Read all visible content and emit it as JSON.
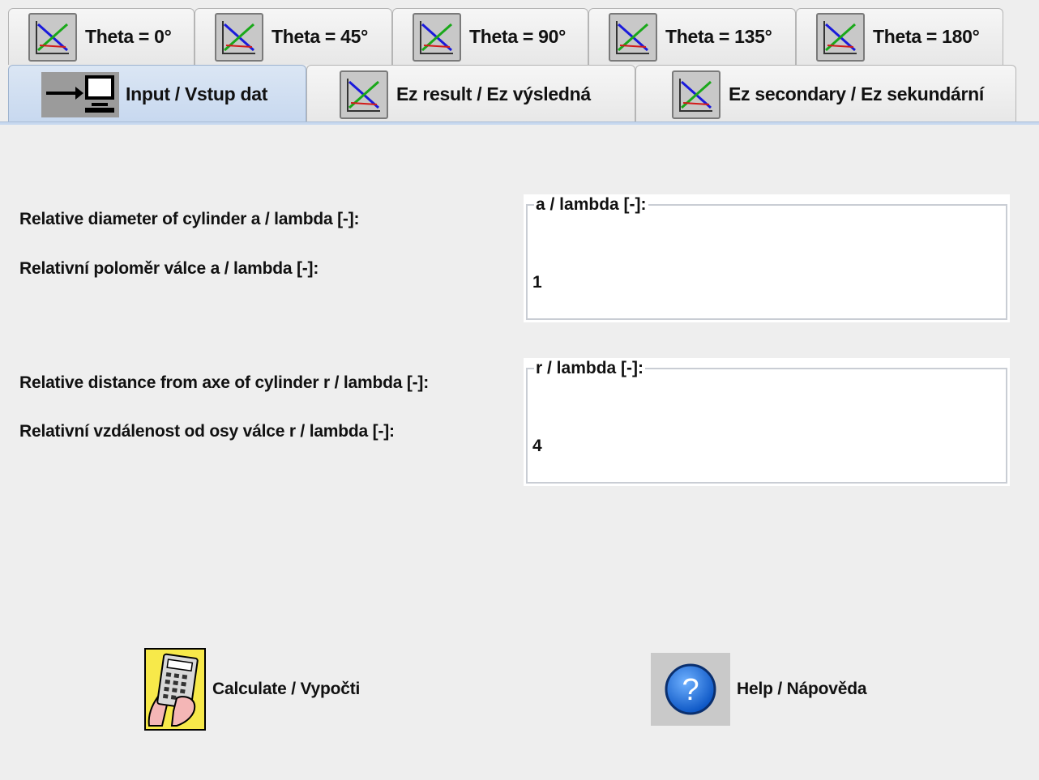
{
  "tabs_row1": [
    {
      "label": "Theta = 0°",
      "icon": "graph-icon"
    },
    {
      "label": "Theta = 45°",
      "icon": "graph-icon"
    },
    {
      "label": "Theta = 90°",
      "icon": "graph-icon"
    },
    {
      "label": "Theta = 135°",
      "icon": "graph-icon"
    },
    {
      "label": "Theta = 180°",
      "icon": "graph-icon"
    }
  ],
  "tabs_row2": [
    {
      "label": "Input / Vstup dat",
      "icon": "input-icon",
      "active": true
    },
    {
      "label": "Ez result / Ez výsledná",
      "icon": "graph-icon"
    },
    {
      "label": "Ez secondary / Ez sekundární",
      "icon": "graph-icon"
    }
  ],
  "form": {
    "diameter": {
      "label_en": "Relative diameter of cylinder a / lambda [-]:",
      "label_cz": "Relativní poloměr válce a / lambda [-]:",
      "group_title": "a / lambda [-]:",
      "value": "1"
    },
    "distance": {
      "label_en": "Relative distance from axe of cylinder r / lambda [-]:",
      "label_cz": "Relativní vzdálenost od osy válce r / lambda [-]:",
      "group_title": "r / lambda [-]:",
      "value": "4"
    }
  },
  "actions": {
    "calculate_label": "Calculate / Vypočti",
    "help_label": "Help / Nápověda"
  },
  "colors": {
    "active_tab": "#c7d8ef",
    "background": "#eeeeee",
    "help_icon": "#1e6fd9",
    "calc_icon_bg": "#f7e94a"
  }
}
